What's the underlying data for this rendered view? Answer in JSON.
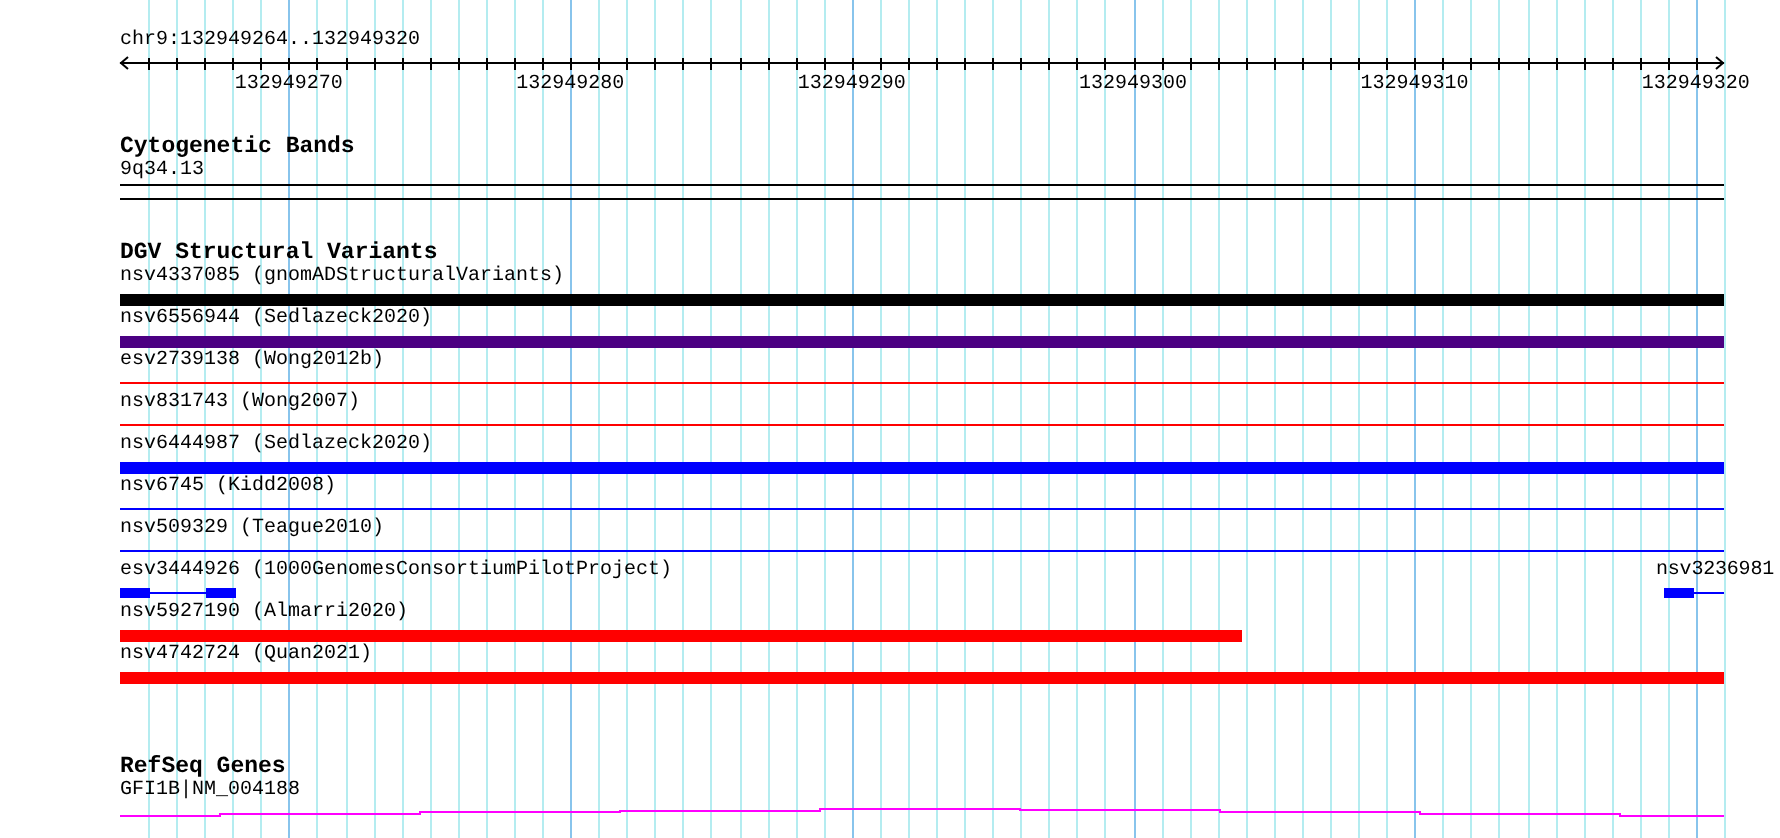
{
  "position": {
    "label": "chr9:132949264..132949320"
  },
  "ruler": {
    "ticks": [
      "132949270",
      "132949280",
      "132949290",
      "132949300",
      "132949310",
      "132949320"
    ]
  },
  "tracks": [
    {
      "kind": "bands",
      "title": "Cytogenetic Bands",
      "items": [
        {
          "label": "9q34.13"
        }
      ]
    },
    {
      "kind": "variants",
      "title": "DGV Structural Variants",
      "rows": [
        {
          "features": [
            {
              "label": "nsv4337085 (gnomADStructuralVariants)",
              "kind": "thick",
              "color": "#000000"
            }
          ]
        },
        {
          "features": [
            {
              "label": "nsv6556944 (Sedlazeck2020)",
              "kind": "thick",
              "color": "#4b0082"
            }
          ]
        },
        {
          "features": [
            {
              "label": "esv2739138 (Wong2012b)",
              "kind": "thin",
              "color": "#ff0000"
            }
          ]
        },
        {
          "features": [
            {
              "label": "nsv831743 (Wong2007)",
              "kind": "thin",
              "color": "#ff0000"
            }
          ]
        },
        {
          "features": [
            {
              "label": "nsv6444987 (Sedlazeck2020)",
              "kind": "thick",
              "color": "#0000ff"
            }
          ]
        },
        {
          "features": [
            {
              "label": "nsv6745 (Kidd2008)",
              "kind": "thin",
              "color": "#0000ff"
            }
          ]
        },
        {
          "features": [
            {
              "label": "nsv509329 (Teague2010)",
              "kind": "thin",
              "color": "#0000ff"
            }
          ]
        },
        {
          "features": [
            {
              "label": "esv3444926 (1000GenomesConsortiumPilotProject)",
              "kind": "gapped-start",
              "color": "#0000ff"
            },
            {
              "label": "nsv3236981",
              "kind": "gapped-end",
              "color": "#0000ff"
            }
          ]
        },
        {
          "features": [
            {
              "label": "nsv5927190 (Almarri2020)",
              "kind": "thick-partial",
              "color": "#ff0000"
            }
          ]
        },
        {
          "features": [
            {
              "label": "nsv4742724 (Quan2021)",
              "kind": "thick",
              "color": "#ff0000"
            }
          ]
        }
      ]
    },
    {
      "kind": "genes",
      "title": "RefSeq Genes",
      "items": [
        {
          "label": "GFI1B|NM_004188"
        }
      ]
    }
  ]
}
